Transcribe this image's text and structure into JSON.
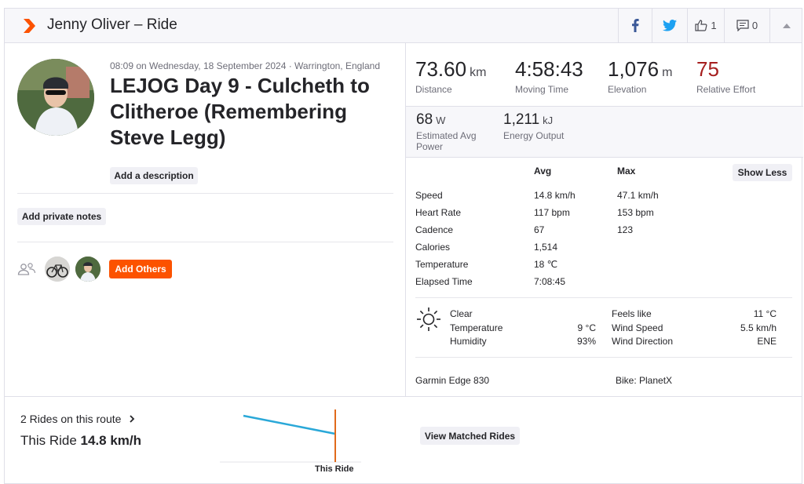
{
  "header": {
    "title": "Jenny Oliver – Ride",
    "kudos_count": "1",
    "comment_count": "0"
  },
  "activity": {
    "meta": "08:09 on Wednesday, 18 September 2024 · Warrington, England",
    "title": "LEJOG Day 9 - Culcheth to Clitheroe (Remembering Steve Legg)",
    "add_description": "Add a description",
    "add_private_notes": "Add private notes",
    "add_others": "Add Others"
  },
  "stats": {
    "distance": {
      "value": "73.60",
      "unit": "km",
      "label": "Distance"
    },
    "moving_time": {
      "value": "4:58:43",
      "label": "Moving Time"
    },
    "elevation": {
      "value": "1,076",
      "unit": "m",
      "label": "Elevation"
    },
    "relative_effort": {
      "value": "75",
      "label": "Relative Effort"
    },
    "power": {
      "value": "68",
      "unit": "W",
      "label": "Estimated Avg Power"
    },
    "energy": {
      "value": "1,211",
      "unit": "kJ",
      "label": "Energy Output"
    }
  },
  "detail_table": {
    "col_avg": "Avg",
    "col_max": "Max",
    "show_less": "Show Less",
    "rows": [
      {
        "label": "Speed",
        "avg": "14.8 km/h",
        "max": "47.1 km/h"
      },
      {
        "label": "Heart Rate",
        "avg": "117 bpm",
        "max": "153 bpm"
      },
      {
        "label": "Cadence",
        "avg": "67",
        "max": "123"
      },
      {
        "label": "Calories",
        "avg": "1,514",
        "max": ""
      },
      {
        "label": "Temperature",
        "avg": "18 ℃",
        "max": ""
      },
      {
        "label": "Elapsed Time",
        "avg": "7:08:45",
        "max": ""
      }
    ]
  },
  "weather": {
    "condition": "Clear",
    "temperature_label": "Temperature",
    "temperature": "9 °C",
    "humidity_label": "Humidity",
    "humidity": "93%",
    "feels_like_label": "Feels like",
    "feels_like": "11 °C",
    "wind_speed_label": "Wind Speed",
    "wind_speed": "5.5 km/h",
    "wind_direction_label": "Wind Direction",
    "wind_direction": "ENE"
  },
  "gear": {
    "device": "Garmin Edge 830",
    "bike": "Bike: PlanetX"
  },
  "matched": {
    "rides_link": "2 Rides on this route",
    "this_ride_prefix": "This Ride",
    "this_ride_speed": "14.8 km/h",
    "chart_label": "This Ride",
    "view_button": "View Matched Rides"
  },
  "colors": {
    "brand": "#fc5200",
    "relative_effort": "#a61f1f",
    "facebook": "#3b5998",
    "twitter": "#1da1f2",
    "trend_line": "#2aa8d8",
    "marker": "#e06a1b"
  }
}
